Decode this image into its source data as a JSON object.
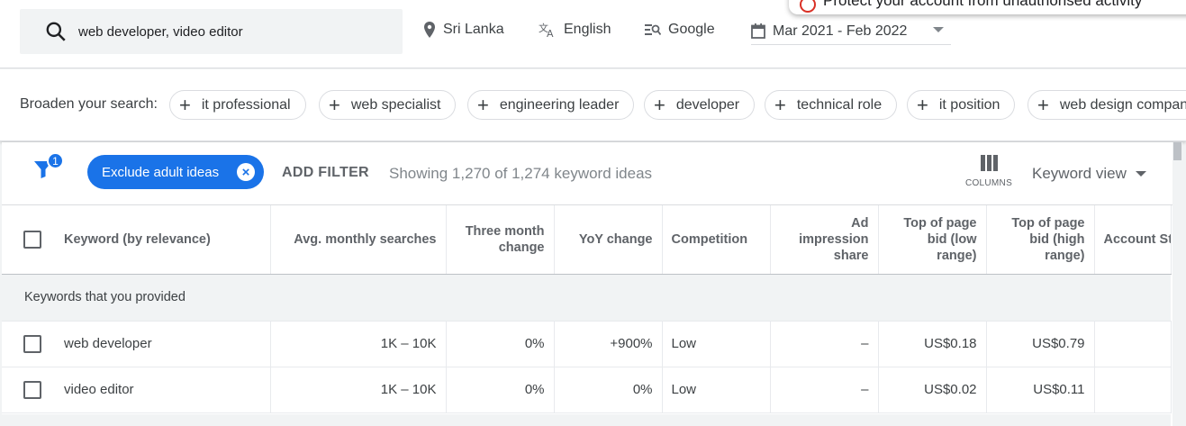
{
  "search": {
    "query": "web developer, video editor"
  },
  "meta": {
    "location": "Sri Lanka",
    "language": "English",
    "network": "Google",
    "date_range": "Mar 2021 - Feb 2022"
  },
  "toast": {
    "text": "Protect your account from unauthorised activity"
  },
  "broaden": {
    "label": "Broaden your search:",
    "chips": [
      "it professional",
      "web specialist",
      "engineering leader",
      "developer",
      "technical role",
      "it position",
      "web design company"
    ]
  },
  "toolbar": {
    "filter_badge": "1",
    "exclude_chip": "Exclude adult ideas",
    "add_filter": "ADD FILTER",
    "showing": "Showing 1,270 of 1,274 keyword ideas",
    "columns_label": "COLUMNS",
    "view_select": "Keyword view"
  },
  "table": {
    "headers": {
      "keyword": "Keyword (by relevance)",
      "avg": "Avg. monthly searches",
      "three_month": "Three month change",
      "yoy": "YoY change",
      "competition": "Competition",
      "ad_share": "Ad impression share",
      "bid_low": "Top of page bid (low range)",
      "bid_high": "Top of page bid (high range)",
      "account": "Account St"
    },
    "group_label": "Keywords that you provided",
    "rows": [
      {
        "keyword": "web developer",
        "avg": "1K – 10K",
        "three_month": "0%",
        "yoy": "+900%",
        "competition": "Low",
        "ad_share": "–",
        "bid_low": "US$0.18",
        "bid_high": "US$0.79",
        "account": ""
      },
      {
        "keyword": "video editor",
        "avg": "1K – 10K",
        "three_month": "0%",
        "yoy": "0%",
        "competition": "Low",
        "ad_share": "–",
        "bid_low": "US$0.02",
        "bid_high": "US$0.11",
        "account": ""
      }
    ]
  }
}
